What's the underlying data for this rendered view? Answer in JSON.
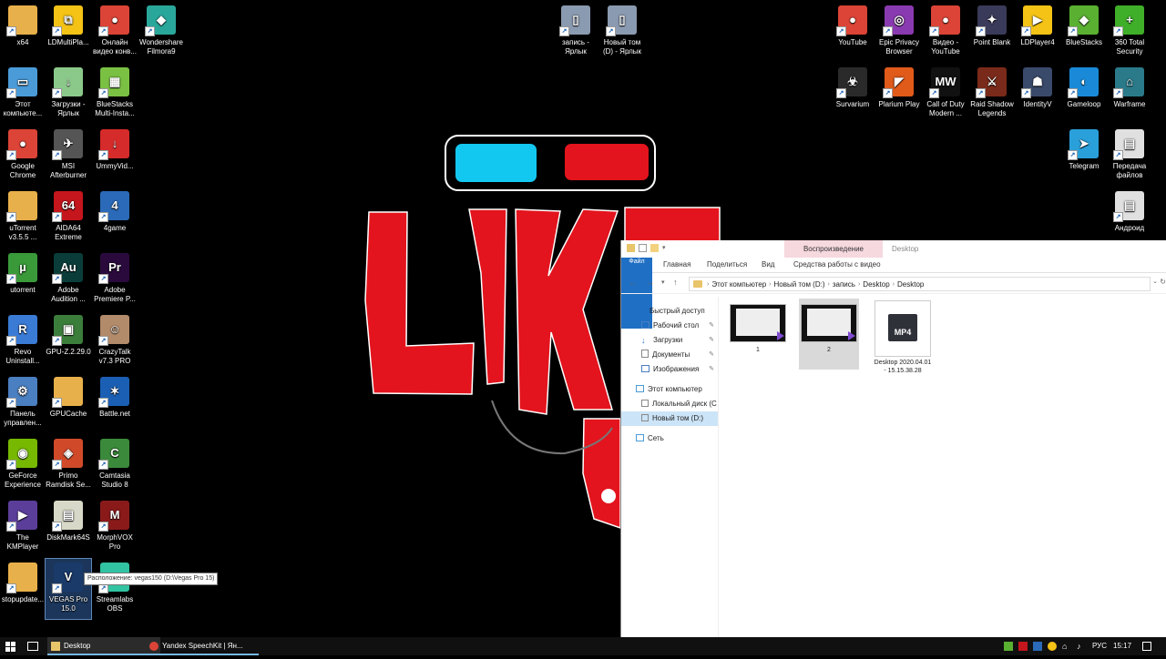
{
  "desktop_icons": [
    {
      "label": "x64",
      "color": "#e8b04a",
      "glyph": ""
    },
    {
      "label": "LDMultiPla...",
      "color": "#f4c316",
      "glyph": "⧉"
    },
    {
      "label": "Онлайн видео конв...",
      "color": "#db4437",
      "glyph": "●"
    },
    {
      "label": "Wondershare Filmora9",
      "color": "#2aa79b",
      "glyph": "◆"
    },
    {
      "label": "Этот компьюте...",
      "color": "#4a9bd8",
      "glyph": "▭"
    },
    {
      "label": "Загрузки - Ярлык",
      "color": "#8bc98a",
      "glyph": "↓"
    },
    {
      "label": "BlueStacks Multi-Insta...",
      "color": "#7ac143",
      "glyph": "▦"
    },
    {
      "label": "Google Chrome",
      "color": "#db4437",
      "glyph": "●"
    },
    {
      "label": "MSI Afterburner",
      "color": "#555",
      "glyph": "✈"
    },
    {
      "label": "UmmyVid...",
      "color": "#d62b2b",
      "glyph": "↓"
    },
    {
      "label": "uTorrent v3.5.5 ...",
      "color": "#e8b04a",
      "glyph": ""
    },
    {
      "label": "AIDA64 Extreme",
      "color": "#c4161c",
      "glyph": "64"
    },
    {
      "label": "4game",
      "color": "#2a6ab8",
      "glyph": "4"
    },
    {
      "label": "utorrent",
      "color": "#3a9a3a",
      "glyph": "µ"
    },
    {
      "label": "Adobe Audition ...",
      "color": "#0a3d3a",
      "glyph": "Au"
    },
    {
      "label": "Adobe Premiere P...",
      "color": "#2a0a3d",
      "glyph": "Pr"
    },
    {
      "label": "Revo Uninstall...",
      "color": "#3a7bd5",
      "glyph": "R"
    },
    {
      "label": "GPU-Z.2.29.0",
      "color": "#3b7d3b",
      "glyph": "▣"
    },
    {
      "label": "CrazyTalk v7.3 PRO",
      "color": "#b28b6b",
      "glyph": "☺"
    },
    {
      "label": "Панель управлен...",
      "color": "#4a7fc1",
      "glyph": "⚙"
    },
    {
      "label": "GPUCache",
      "color": "#e8b04a",
      "glyph": ""
    },
    {
      "label": "Battle.net",
      "color": "#1b5fb4",
      "glyph": "✶"
    },
    {
      "label": "GeForce Experience",
      "color": "#76b900",
      "glyph": "◉"
    },
    {
      "label": "Primo Ramdisk Se...",
      "color": "#d04a2a",
      "glyph": "◈"
    },
    {
      "label": "Camtasia Studio 8",
      "color": "#3b8a3b",
      "glyph": "C"
    },
    {
      "label": "The KMPlayer",
      "color": "#5b3e9a",
      "glyph": "▶"
    },
    {
      "label": "DiskMark64S",
      "color": "#d8d8c8",
      "glyph": "▤"
    },
    {
      "label": "MorphVOX Pro",
      "color": "#8a1a1a",
      "glyph": "M"
    },
    {
      "label": "stopupdate...",
      "color": "#e8b04a",
      "glyph": ""
    },
    {
      "label": "VEGAS Pro 15.0",
      "color": "#1a3a6a",
      "glyph": "V"
    },
    {
      "label": "Streamlabs OBS",
      "color": "#31c3a2",
      "glyph": "▭"
    },
    {
      "label": "запись - Ярлык",
      "color": "#8a9ab0",
      "glyph": "▯"
    },
    {
      "label": "Новый том (D) - Ярлык",
      "color": "#8a9ab0",
      "glyph": "▯"
    },
    {
      "label": "YouTube",
      "color": "#db4437",
      "glyph": "●"
    },
    {
      "label": "Epic Privacy Browser",
      "color": "#8a3ab0",
      "glyph": "◎"
    },
    {
      "label": "Видео - YouTube",
      "color": "#db4437",
      "glyph": "●"
    },
    {
      "label": "Point Blank",
      "color": "#3a3a5a",
      "glyph": "✦"
    },
    {
      "label": "LDPlayer4",
      "color": "#f4c316",
      "glyph": "▶"
    },
    {
      "label": "BlueStacks",
      "color": "#5ab031",
      "glyph": "◆"
    },
    {
      "label": "360 Total Security",
      "color": "#3fae29",
      "glyph": "+"
    },
    {
      "label": "Survarium",
      "color": "#2a2a2a",
      "glyph": "☣"
    },
    {
      "label": "Plarium Play",
      "color": "#e05a1a",
      "glyph": "◤"
    },
    {
      "label": "Call of Duty Modern ...",
      "color": "#111",
      "glyph": "MW"
    },
    {
      "label": "Raid Shadow Legends",
      "color": "#7a2a1a",
      "glyph": "⚔"
    },
    {
      "label": "IdentityV",
      "color": "#3a4a6a",
      "glyph": "☗"
    },
    {
      "label": "Gameloop",
      "color": "#1a8ad8",
      "glyph": "◐"
    },
    {
      "label": "Warframe",
      "color": "#2a7a8a",
      "glyph": "⌂"
    },
    {
      "label": "Telegram",
      "color": "#2aa0da",
      "glyph": "➤"
    },
    {
      "label": "Передача файлов",
      "color": "#e0e0e0",
      "glyph": "▤"
    },
    {
      "label": "Андроид",
      "color": "#e0e0e0",
      "glyph": "▤"
    }
  ],
  "tooltip": "Расположение: vegas150 (D:\\Vegas Pro 15)",
  "explorer": {
    "context_group": "Воспроизведение",
    "title": "Desktop",
    "tabs": [
      "Файл",
      "Главная",
      "Поделиться",
      "Вид",
      "Средства работы с видео"
    ],
    "breadcrumb": [
      "Этот компьютер",
      "Новый том (D:)",
      "запись",
      "Desktop",
      "Desktop"
    ],
    "nav": {
      "quick_access": "Быстрый доступ",
      "desktop": "Рабочий стол",
      "downloads": "Загрузки",
      "documents": "Документы",
      "pictures": "Изображения",
      "this_pc": "Этот компьютер",
      "local_disk": "Локальный диск (C",
      "new_volume": "Новый том (D:)",
      "network": "Сеть"
    },
    "files": [
      {
        "name": "1"
      },
      {
        "name": "2"
      },
      {
        "name": "Desktop 2020.04.01 - 15.15.38.28",
        "badge": "MP4"
      }
    ]
  },
  "taskbar": {
    "tasks": [
      {
        "label": "Desktop"
      },
      {
        "label": "Yandex SpeechKit | Ян..."
      }
    ],
    "language": "РУС",
    "time": "15:17"
  }
}
